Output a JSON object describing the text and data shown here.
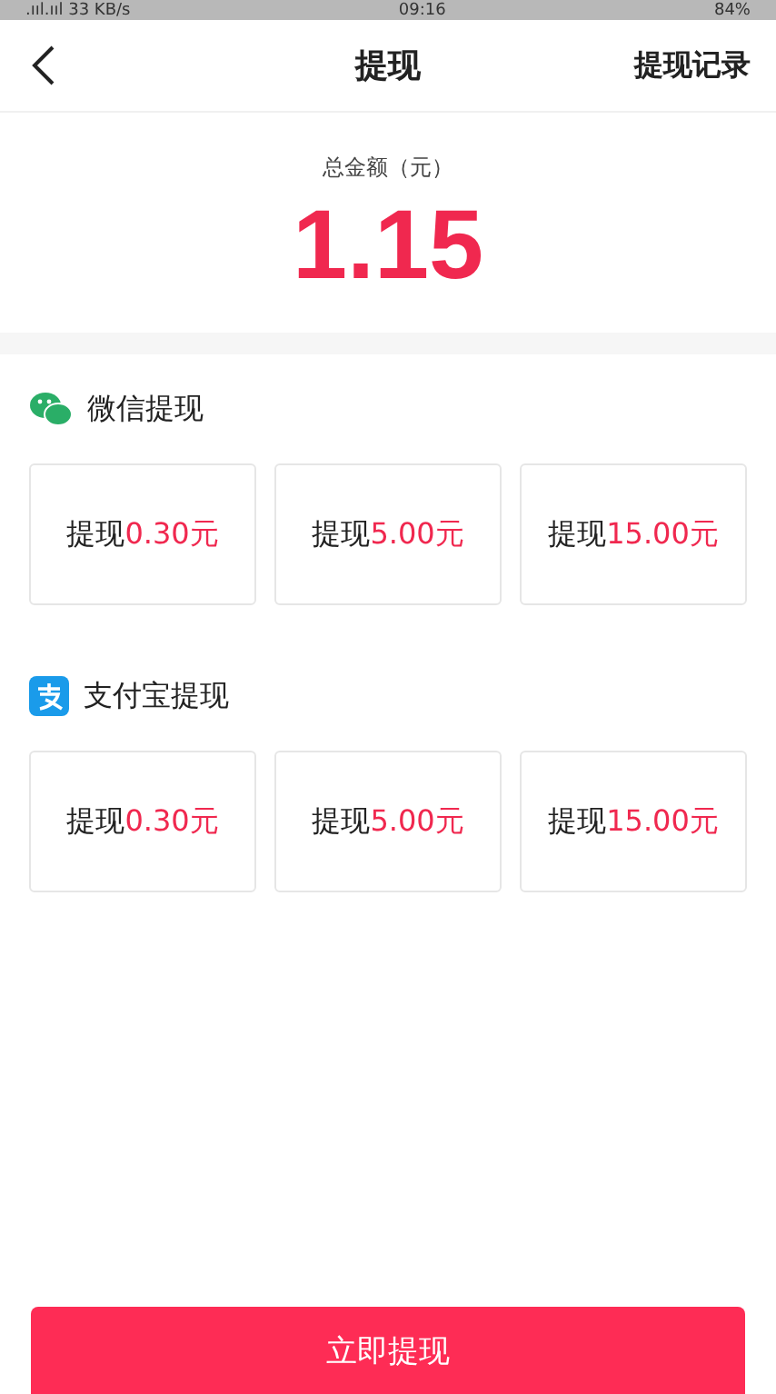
{
  "status_bar": {
    "signal": ".ııl.ııl",
    "speed": "33 KB/s",
    "time": "09:16",
    "battery": "84%"
  },
  "header": {
    "title": "提现",
    "action": "提现记录"
  },
  "balance": {
    "label": "总金额（元）",
    "amount": "1.15"
  },
  "sections": [
    {
      "kind": "wechat",
      "title": "微信提现",
      "options": [
        {
          "prefix": "提现",
          "amount": "0.30元"
        },
        {
          "prefix": "提现",
          "amount": "5.00元"
        },
        {
          "prefix": "提现",
          "amount": "15.00元"
        }
      ]
    },
    {
      "kind": "alipay",
      "title": "支付宝提现",
      "options": [
        {
          "prefix": "提现",
          "amount": "0.30元"
        },
        {
          "prefix": "提现",
          "amount": "5.00元"
        },
        {
          "prefix": "提现",
          "amount": "15.00元"
        }
      ]
    }
  ],
  "submit": "立即提现"
}
